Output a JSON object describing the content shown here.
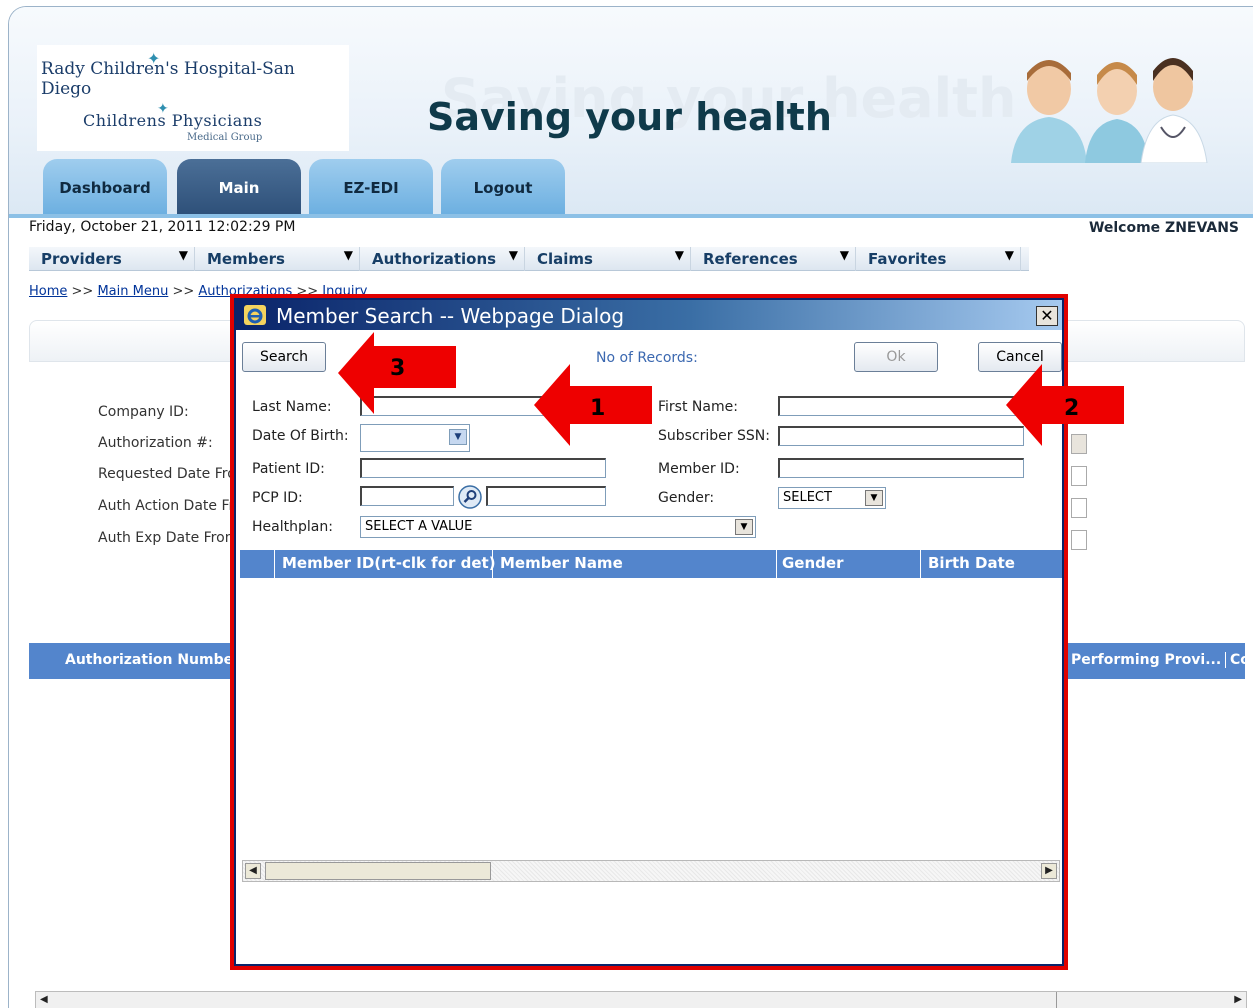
{
  "header": {
    "logo_line1": "Rady Children's Hospital-San Diego",
    "logo_line2": "Childrens Physicians",
    "logo_line3": "Medical Group",
    "tagline": "Saving your health",
    "tagline_shadow": "Saving your health"
  },
  "tabs": [
    {
      "label": "Dashboard"
    },
    {
      "label": "Main"
    },
    {
      "label": "EZ-EDI"
    },
    {
      "label": "Logout"
    }
  ],
  "status": {
    "datetime": "Friday, October 21, 2011 12:02:29 PM",
    "welcome": "Welcome ZNEVANS"
  },
  "menu": [
    {
      "label": "Providers"
    },
    {
      "label": "Members"
    },
    {
      "label": "Authorizations"
    },
    {
      "label": "Claims"
    },
    {
      "label": "References"
    },
    {
      "label": "Favorites"
    }
  ],
  "breadcrumb": {
    "home": "Home",
    "main_menu": "Main Menu",
    "authorizations": "Authorizations",
    "inquiry": "Inquiry",
    "separator": " >> "
  },
  "background_form": {
    "labels": [
      "Company ID:",
      "Authorization #:",
      "Requested Date Fro",
      "Auth Action Date Fr",
      "Auth Exp Date From"
    ],
    "results_columns": [
      "Authorization Numbe",
      "Performing Provi...",
      "Co"
    ]
  },
  "dialog": {
    "title": "Member Search -- Webpage Dialog",
    "close": "✕",
    "search_button": "Search",
    "records_label": "No of Records:",
    "ok_button": "Ok",
    "cancel_button": "Cancel",
    "fields": {
      "last_name": "Last Name:",
      "first_name": "First Name:",
      "dob": "Date Of Birth:",
      "ssn": "Subscriber SSN:",
      "patient_id": "Patient ID:",
      "member_id": "Member ID:",
      "pcp_id": "PCP ID:",
      "gender": "Gender:",
      "healthplan": "Healthplan:"
    },
    "gender_value": "SELECT",
    "healthplan_value": "SELECT A VALUE",
    "grid_columns": [
      "Member ID(rt-clk for det)",
      "Member Name",
      "Gender",
      "Birth Date"
    ]
  },
  "callouts": [
    "1",
    "2",
    "3"
  ],
  "colors": {
    "highlight_red": "#e00000",
    "grid_header": "#5385cc",
    "title_bar": "#0a246a"
  }
}
